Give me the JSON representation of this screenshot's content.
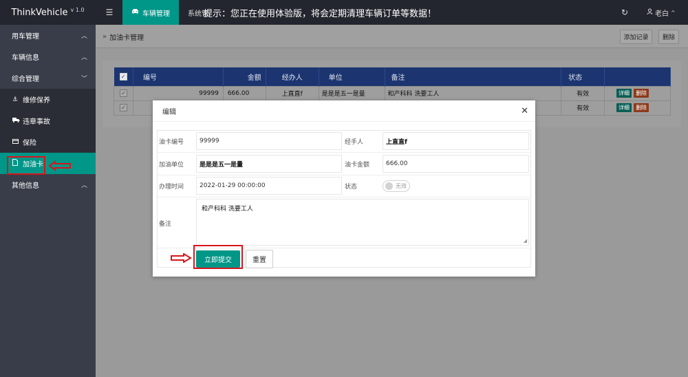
{
  "header": {
    "brand_name": "ThinkVehicle",
    "brand_version": "v 1.0",
    "menu_icon": "hamburger-icon",
    "nav_active_label": "车辆管理",
    "nav_system_label": "系统管",
    "notice": "提示：您正在使用体验版，将会定期清理车辆订单等数据！",
    "user_name": "老白"
  },
  "sidebar": {
    "groups": [
      {
        "label": "用车管理"
      },
      {
        "label": "车辆信息"
      },
      {
        "label": "综合管理"
      },
      {
        "label": "其他信息"
      }
    ],
    "items": [
      {
        "label": "维修保养",
        "icon": "anchor-icon"
      },
      {
        "label": "违章事故",
        "icon": "truck-icon"
      },
      {
        "label": "保险",
        "icon": "card-icon"
      },
      {
        "label": "加油卡",
        "icon": "file-icon"
      }
    ]
  },
  "main": {
    "breadcrumb": "加油卡管理",
    "add_label": "添加记录",
    "delete_label": "删除",
    "table": {
      "columns": [
        "编号",
        "金额",
        "经办人",
        "单位",
        "备注",
        "状态"
      ],
      "rows": [
        {
          "id": "99999",
          "amount": "666.00",
          "handler": "上直直f",
          "unit": "是是是五一是量",
          "remark": "和产科科 洗要工人",
          "status": "有效",
          "detail": "详细",
          "del": "删除"
        },
        {
          "status": "有效",
          "detail": "详细",
          "del": "删除"
        }
      ]
    }
  },
  "modal": {
    "title": "编辑",
    "fields": {
      "card_no_label": "油卡编号",
      "card_no_value": "99999",
      "handler_label": "经手人",
      "handler_value": "上直直f",
      "unit_label": "加油单位",
      "unit_value": "是是是五一是量",
      "amount_label": "油卡金额",
      "amount_value": "666.00",
      "time_label": "办理时间",
      "time_value": "2022-01-29 00:00:00",
      "status_label": "状态",
      "status_value": "无效",
      "remark_label": "备注",
      "remark_value": "和产科科  洗要工人"
    },
    "submit_label": "立即提交",
    "reset_label": "重置"
  },
  "colors": {
    "accent": "#009688",
    "header_bg": "#23262e",
    "sidebar_bg": "#393d49",
    "annotation": "#d9141a"
  }
}
